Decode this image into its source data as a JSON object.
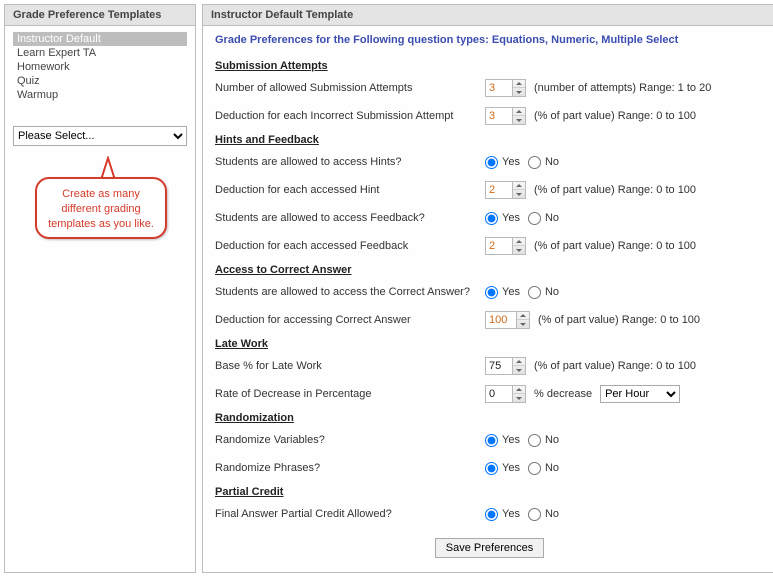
{
  "left": {
    "title": "Grade Preference Templates",
    "items": [
      "Instructor Default",
      "Learn Expert TA",
      "Homework",
      "Quiz",
      "Warmup"
    ],
    "selected_index": 0,
    "select_placeholder": "Please Select...",
    "callout": "Create as many different grading templates as you like."
  },
  "right": {
    "title": "Instructor Default Template",
    "subtitle": "Grade Preferences for the Following question types: Equations, Numeric, Multiple Select",
    "sections": {
      "submission": {
        "header": "Submission Attempts",
        "attempts_label": "Number of allowed Submission Attempts",
        "attempts_value": "3",
        "attempts_suffix": "(number of attempts) Range: 1 to 20",
        "deduction_label": "Deduction for each Incorrect Submission Attempt",
        "deduction_value": "3",
        "deduction_suffix": "(% of part value) Range: 0 to 100"
      },
      "hints": {
        "header": "Hints and Feedback",
        "hints_access_label": "Students are allowed to access Hints?",
        "hints_deduction_label": "Deduction for each accessed Hint",
        "hints_deduction_value": "2",
        "feedback_access_label": "Students are allowed to access Feedback?",
        "feedback_deduction_label": "Deduction for each accessed Feedback",
        "feedback_deduction_value": "2",
        "pct_suffix": "(% of part value) Range: 0 to 100"
      },
      "answer": {
        "header": "Access to Correct Answer",
        "access_label": "Students are allowed to access the Correct Answer?",
        "deduction_label": "Deduction for accessing Correct Answer",
        "deduction_value": "100",
        "pct_suffix": "(% of part value) Range: 0 to 100"
      },
      "late": {
        "header": "Late Work",
        "base_label": "Base % for Late Work",
        "base_value": "75",
        "base_suffix": "(% of part value) Range: 0 to 100",
        "rate_label": "Rate of Decrease in Percentage",
        "rate_value": "0",
        "rate_mid": "% decrease",
        "rate_unit": "Per Hour"
      },
      "random": {
        "header": "Randomization",
        "vars_label": "Randomize Variables?",
        "phrases_label": "Randomize Phrases?"
      },
      "partial": {
        "header": "Partial Credit",
        "final_label": "Final Answer Partial Credit Allowed?"
      }
    },
    "yes": "Yes",
    "no": "No",
    "save": "Save Preferences"
  }
}
